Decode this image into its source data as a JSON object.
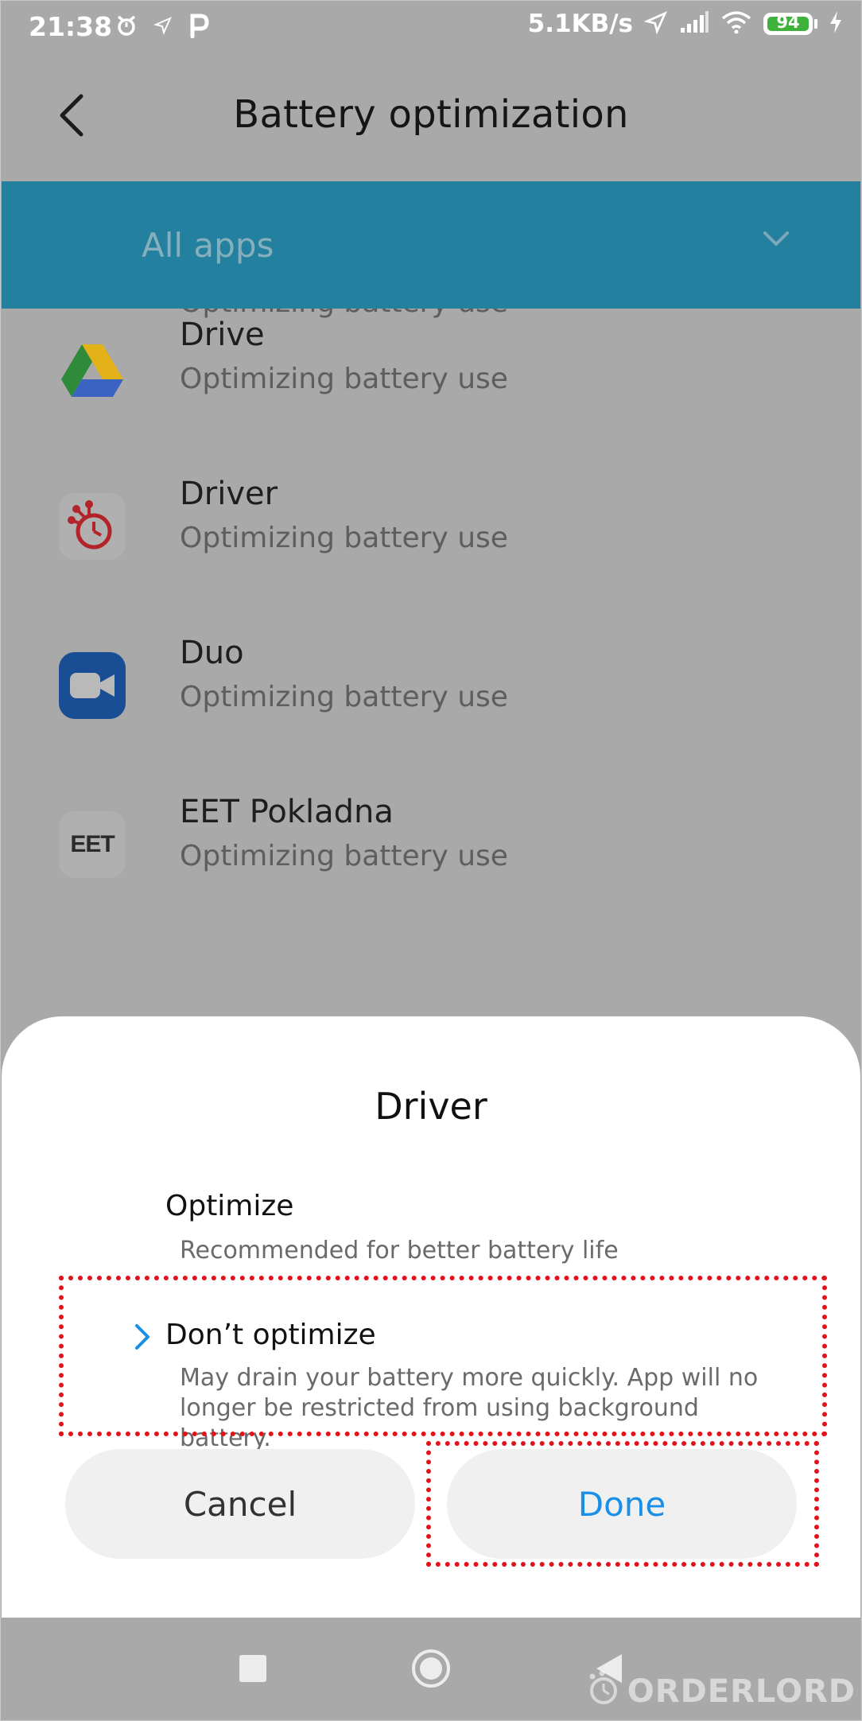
{
  "status_bar": {
    "time": "21:38",
    "net_speed": "5.1KB/s",
    "battery_level": "94",
    "icons": [
      "alarm-icon",
      "location-arrow-icon",
      "p-app-icon",
      "location-icon",
      "signal-icon",
      "wifi-icon",
      "battery-icon",
      "charging-icon"
    ]
  },
  "header": {
    "title": "Battery optimization",
    "back_icon": "back-arrow-icon"
  },
  "filter": {
    "label": "All apps",
    "icon": "chevron-down-icon",
    "color": "#23809f"
  },
  "apps": [
    {
      "name": "",
      "status": "Optimizing battery use",
      "icon": "green-app-icon"
    },
    {
      "name": "Drive",
      "status": "Optimizing battery use",
      "icon": "google-drive-icon"
    },
    {
      "name": "Driver",
      "status": "Optimizing battery use",
      "icon": "driver-app-icon"
    },
    {
      "name": "Duo",
      "status": "Optimizing battery use",
      "icon": "google-duo-icon"
    },
    {
      "name": "EET Pokladna",
      "status": "Optimizing battery use",
      "icon": "eet-pokladna-icon",
      "icon_text": "EET"
    }
  ],
  "dialog": {
    "title": "Driver",
    "options": [
      {
        "title": "Optimize",
        "description": "Recommended for better battery life",
        "selected": false
      },
      {
        "title": "Don’t optimize",
        "description": "May drain your battery more quickly. App will no longer be restricted from using background battery.",
        "selected": true
      }
    ],
    "cancel_label": "Cancel",
    "done_label": "Done",
    "accent_color": "#1a8fe7",
    "highlight_color": "#e0121a"
  },
  "nav_bar": {
    "buttons": [
      "recents-square-icon",
      "home-circle-icon",
      "back-triangle-icon"
    ]
  },
  "watermark": {
    "text": "ORDERLORD"
  }
}
